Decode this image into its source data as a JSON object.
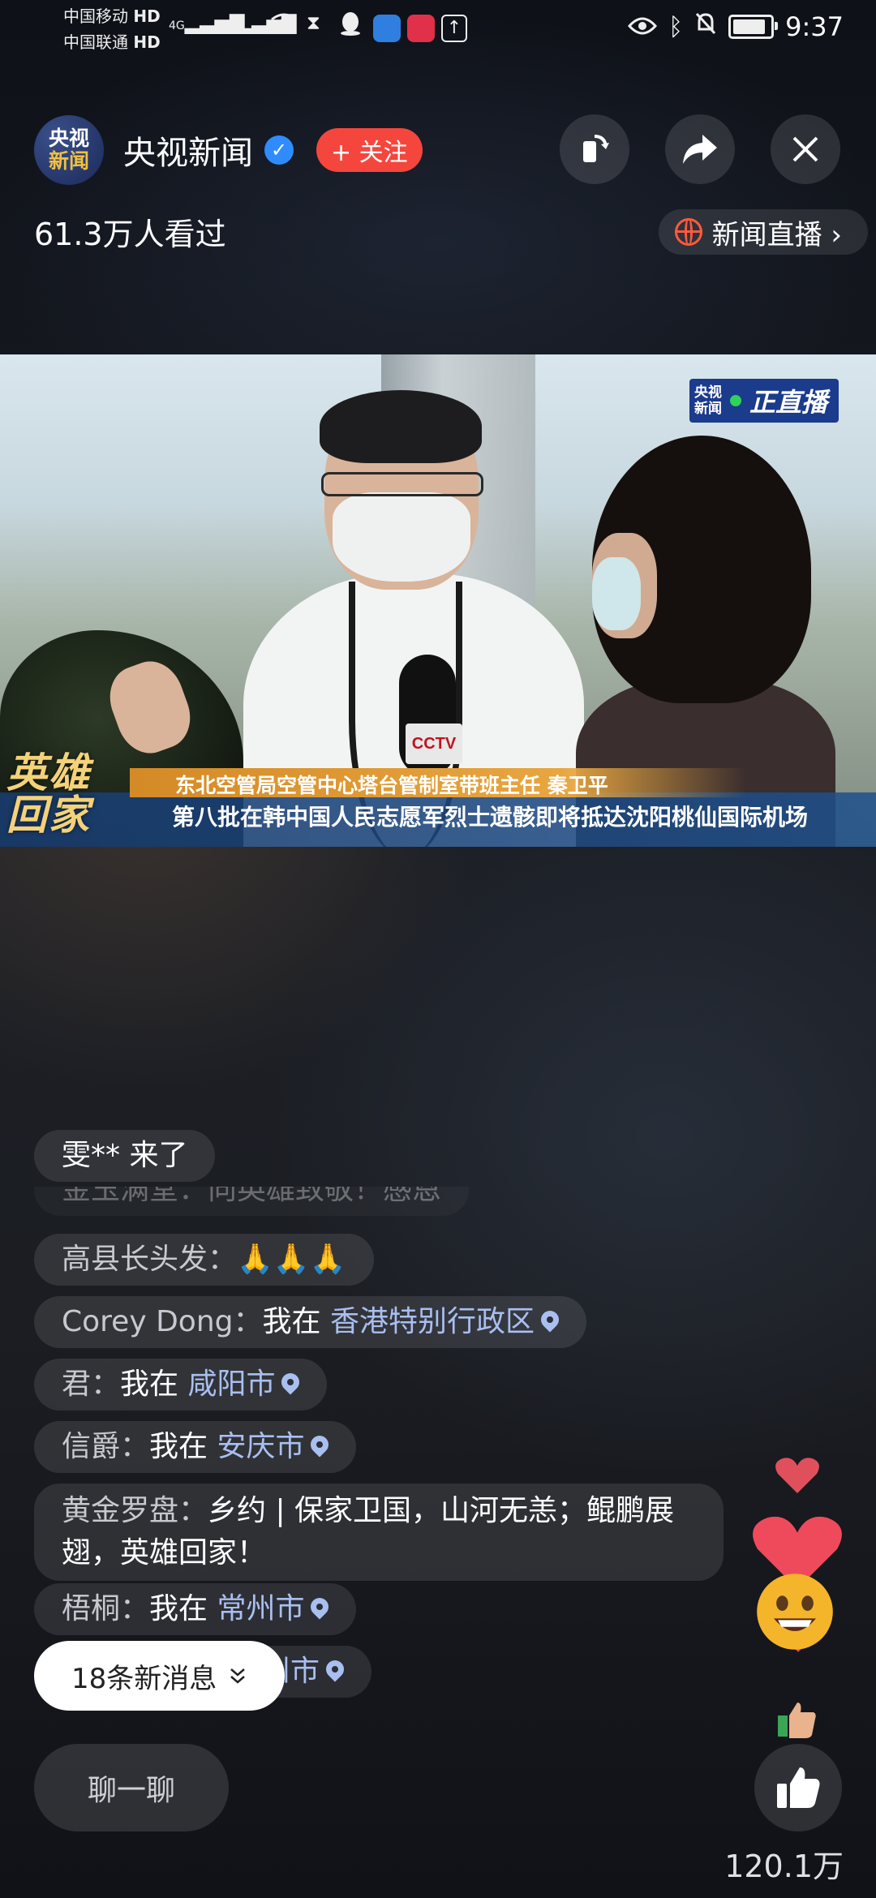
{
  "status_bar": {
    "carrier_1": "中国移动",
    "carrier_2": "中国联通",
    "hd": "HD",
    "net": "4G",
    "time": "9:37"
  },
  "header": {
    "logo_text_1": "央视",
    "logo_text_2": "新闻",
    "channel_name": "央视新闻",
    "follow_label": "+ 关注",
    "viewers": "61.3万人看过",
    "news_live_label": "新闻直播 ›"
  },
  "video": {
    "live_badge_logo_1": "央视",
    "live_badge_logo_2": "新闻",
    "live_badge_text": "正直播",
    "mic_logo": "CCTV",
    "hero_title": "英雄回家",
    "caption_speaker": "东北空管局空管中心塔台管制室带班主任 秦卫平",
    "caption_headline": "第八批在韩中国人民志愿军烈士遗骸即将抵达沈阳桃仙国际机场"
  },
  "chat": {
    "arrival": "雯** 来了",
    "faded_line": "金玉满堂：向英雄致敬！感恩",
    "messages": [
      {
        "user": "高县长头发：",
        "text": "🙏🙏🙏",
        "loc": ""
      },
      {
        "user": "Corey Dong：",
        "text": "我在 ",
        "loc": "香港特别行政区"
      },
      {
        "user": "君：",
        "text": "我在 ",
        "loc": "咸阳市"
      },
      {
        "user": "信爵：",
        "text": "我在 ",
        "loc": "安庆市"
      },
      {
        "user": "黄金罗盘：",
        "text": "乡约 | 保家卫国，山河无恙；鲲鹏展翅，英雄回家！",
        "loc": ""
      },
      {
        "user": "梧桐：",
        "text": "我在 ",
        "loc": "常州市"
      },
      {
        "user": "",
        "text": "",
        "loc": "州市"
      }
    ],
    "new_messages": "18条新消息",
    "input_placeholder": "聊一聊"
  },
  "likes": {
    "count": "120.1万"
  },
  "colors": {
    "follow": "#f5463e",
    "verified": "#2f8cff",
    "live_badge": "#1b3b8c",
    "location": "#a9bff0"
  }
}
